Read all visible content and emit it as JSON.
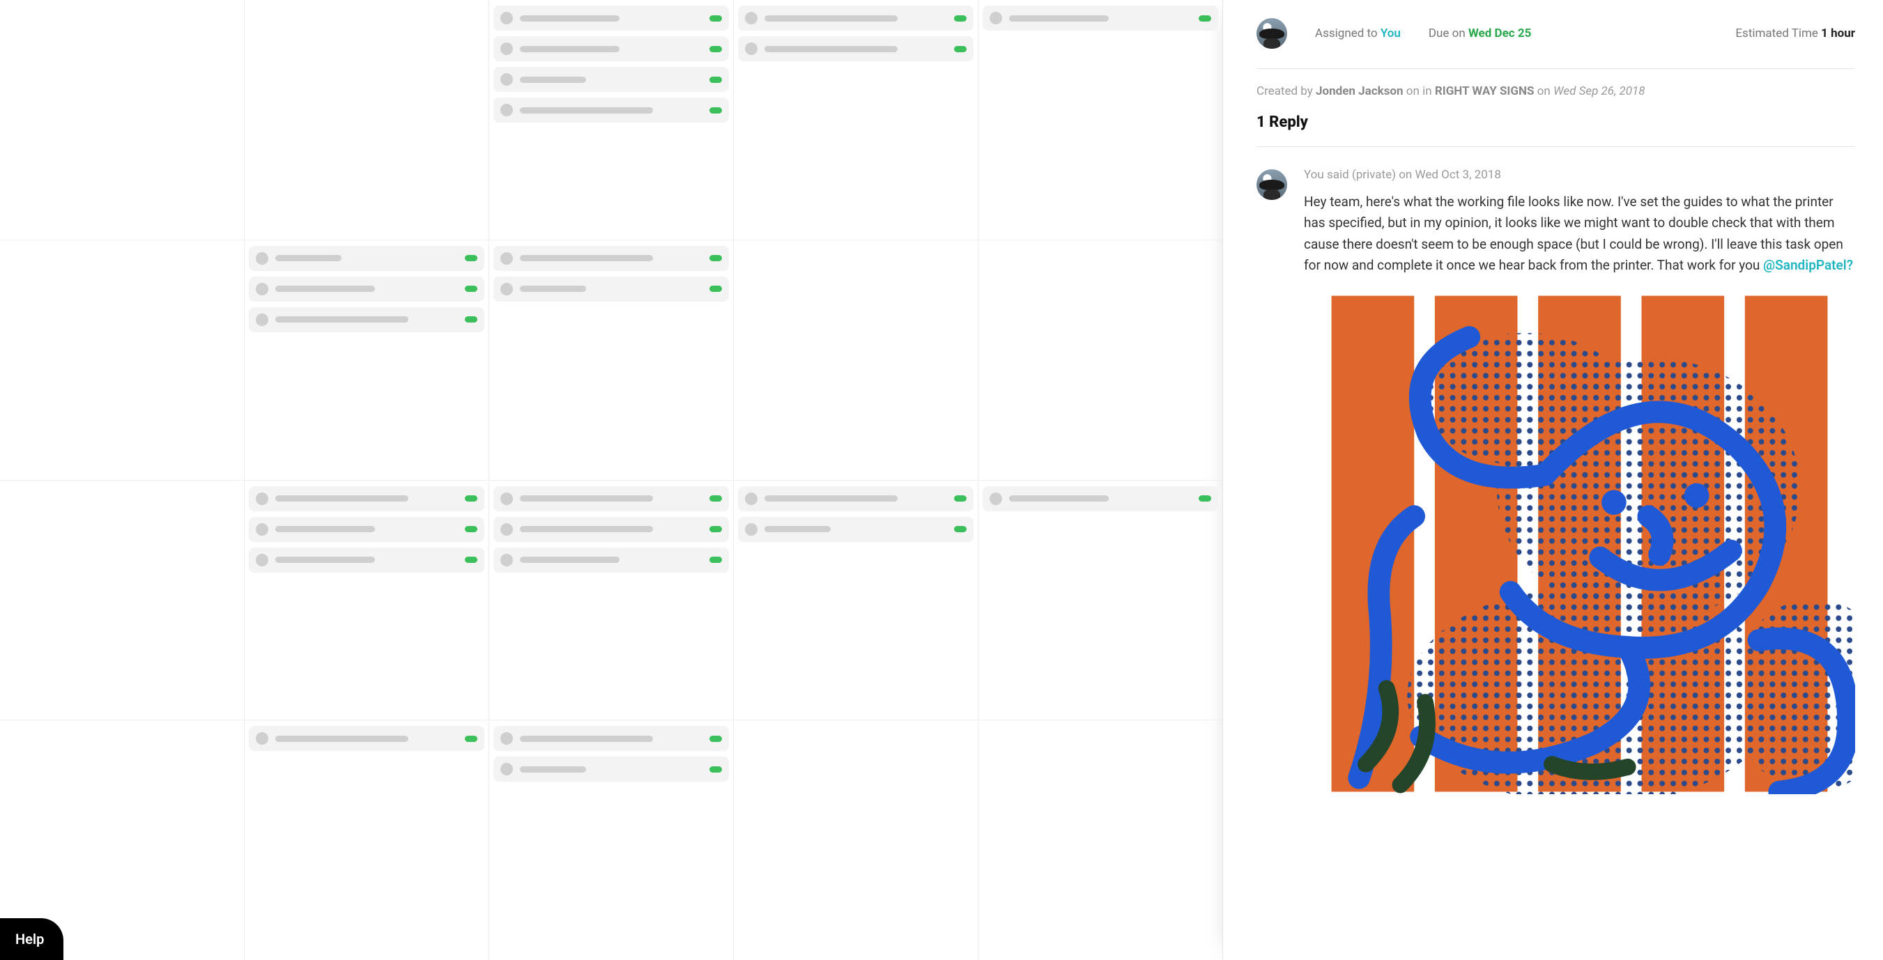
{
  "meta": {
    "assigned_label": "Assigned to",
    "assigned_to": "You",
    "due_label": "Due on",
    "due_date": "Wed Dec 25",
    "estimated_label": "Estimated Time",
    "estimated_value": "1 hour"
  },
  "created": {
    "prefix": "Created by",
    "author": "Jonden Jackson",
    "mid": "on in",
    "project": "RIGHT WAY SIGNS",
    "on": "on",
    "date": "Wed Sep 26, 2018"
  },
  "replies": {
    "header": "1 Reply",
    "items": [
      {
        "meta": "You said (private) on Wed Oct 3, 2018",
        "text": "Hey team, here's what the working file looks like now. I've set the guides to what the printer has specified, but in my opinion, it looks like we might want to double check that with them cause there doesn't seem to be enough space (but I could be wrong). I'll leave this task open for now and complete it once we hear back from the printer. That work for you ",
        "mention": "@SandipPatel?"
      }
    ]
  },
  "help": {
    "label": "Help"
  },
  "board": {
    "rows": [
      {
        "cells": [
          {
            "cards": []
          },
          {
            "cards": []
          },
          {
            "cards": [
              "med",
              "med",
              "short",
              "long"
            ]
          },
          {
            "cards": [
              "long",
              "long"
            ]
          },
          {
            "cards": [
              "med"
            ]
          }
        ]
      },
      {
        "cells": [
          {
            "cards": []
          },
          {
            "cards": [
              "short",
              "med",
              "long"
            ]
          },
          {
            "cards": [
              "long",
              "short"
            ]
          },
          {
            "cards": []
          },
          {
            "cards": []
          }
        ]
      },
      {
        "cells": [
          {
            "cards": []
          },
          {
            "cards": [
              "long",
              "med",
              "med"
            ]
          },
          {
            "cards": [
              "long",
              "long",
              "med"
            ]
          },
          {
            "cards": [
              "long",
              "short"
            ]
          },
          {
            "cards": [
              "med"
            ]
          }
        ]
      },
      {
        "cells": [
          {
            "cards": []
          },
          {
            "cards": [
              "long"
            ]
          },
          {
            "cards": [
              "long",
              "short"
            ]
          },
          {
            "cards": []
          },
          {
            "cards": []
          }
        ]
      }
    ]
  }
}
